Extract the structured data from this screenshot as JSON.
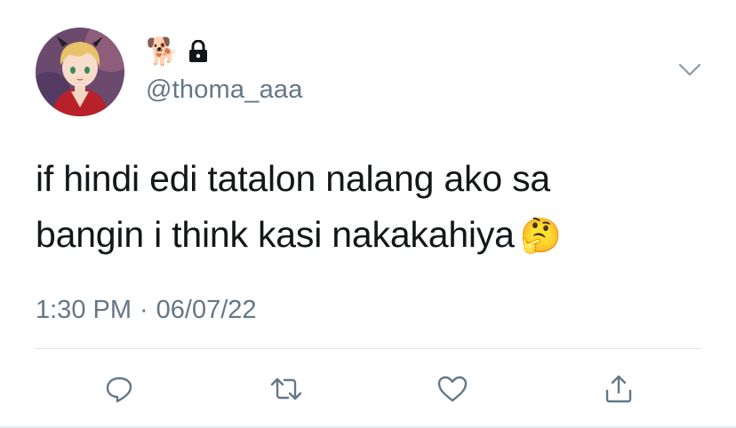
{
  "profile": {
    "display_name_emoji": "🐕",
    "handle": "@thoma_aaa",
    "protected": true
  },
  "tweet": {
    "lines": [
      "if hindi edi tatalon nalang ako sa",
      "bangin i think kasi nakakahiya"
    ],
    "emoji": "🤔"
  },
  "meta": {
    "time": "1:30 PM",
    "separator": "·",
    "date": "06/07/22"
  },
  "actions": [
    "reply-icon",
    "retweet-icon",
    "like-icon",
    "share-icon"
  ],
  "colors": {
    "text": "#14171a",
    "secondary": "#657786",
    "icon": "#657786",
    "divider": "#e1e8ed"
  }
}
